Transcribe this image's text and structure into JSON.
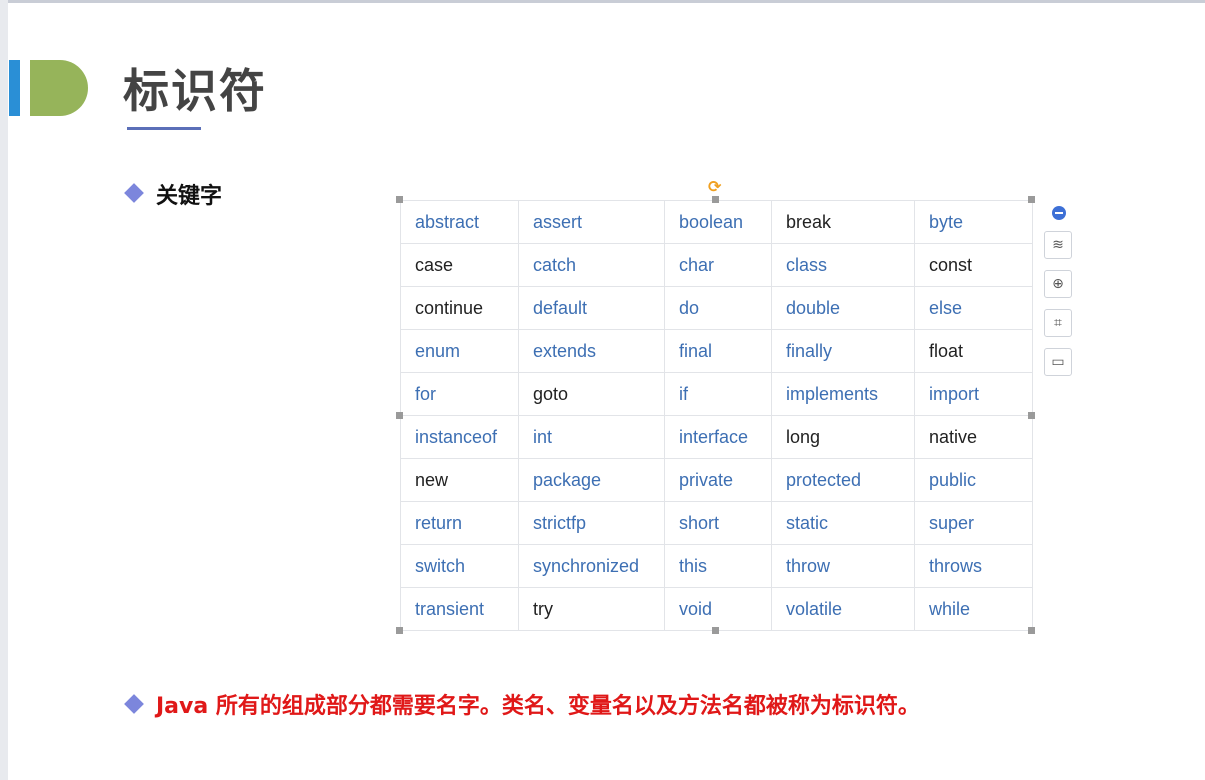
{
  "slide": {
    "title": "标识符",
    "bullet1": "关键字",
    "bullet2": "Java 所有的组成部分都需要名字。类名、变量名以及方法名都被称为标识符。"
  },
  "keywords_table": {
    "rows": [
      [
        "abstract",
        "assert",
        "boolean",
        "break",
        "byte"
      ],
      [
        "case",
        "catch",
        "char",
        "class",
        "const"
      ],
      [
        "continue",
        "default",
        "do",
        "double",
        "else"
      ],
      [
        "enum",
        "extends",
        "final",
        "finally",
        "float"
      ],
      [
        "for",
        "goto",
        "if",
        "implements",
        "import"
      ],
      [
        "instanceof",
        "int",
        "interface",
        "long",
        "native"
      ],
      [
        "new",
        "package",
        "private",
        "protected",
        "public"
      ],
      [
        "return",
        "strictfp",
        "short",
        "static",
        "super"
      ],
      [
        "switch",
        "synchronized",
        "this",
        "throw",
        "throws"
      ],
      [
        "transient",
        "try",
        "void",
        "volatile",
        "while"
      ]
    ]
  },
  "side_toolbar": {
    "icons": [
      "minus-icon",
      "layers-icon",
      "zoom-in-icon",
      "crop-icon",
      "frame-icon"
    ]
  },
  "colors": {
    "keyword_blue": "#3d6fb3",
    "keyword_dark": "#222222",
    "bullet_red": "#e01818",
    "accent_blue": "#2a8fd6",
    "accent_green": "#96b45a"
  }
}
